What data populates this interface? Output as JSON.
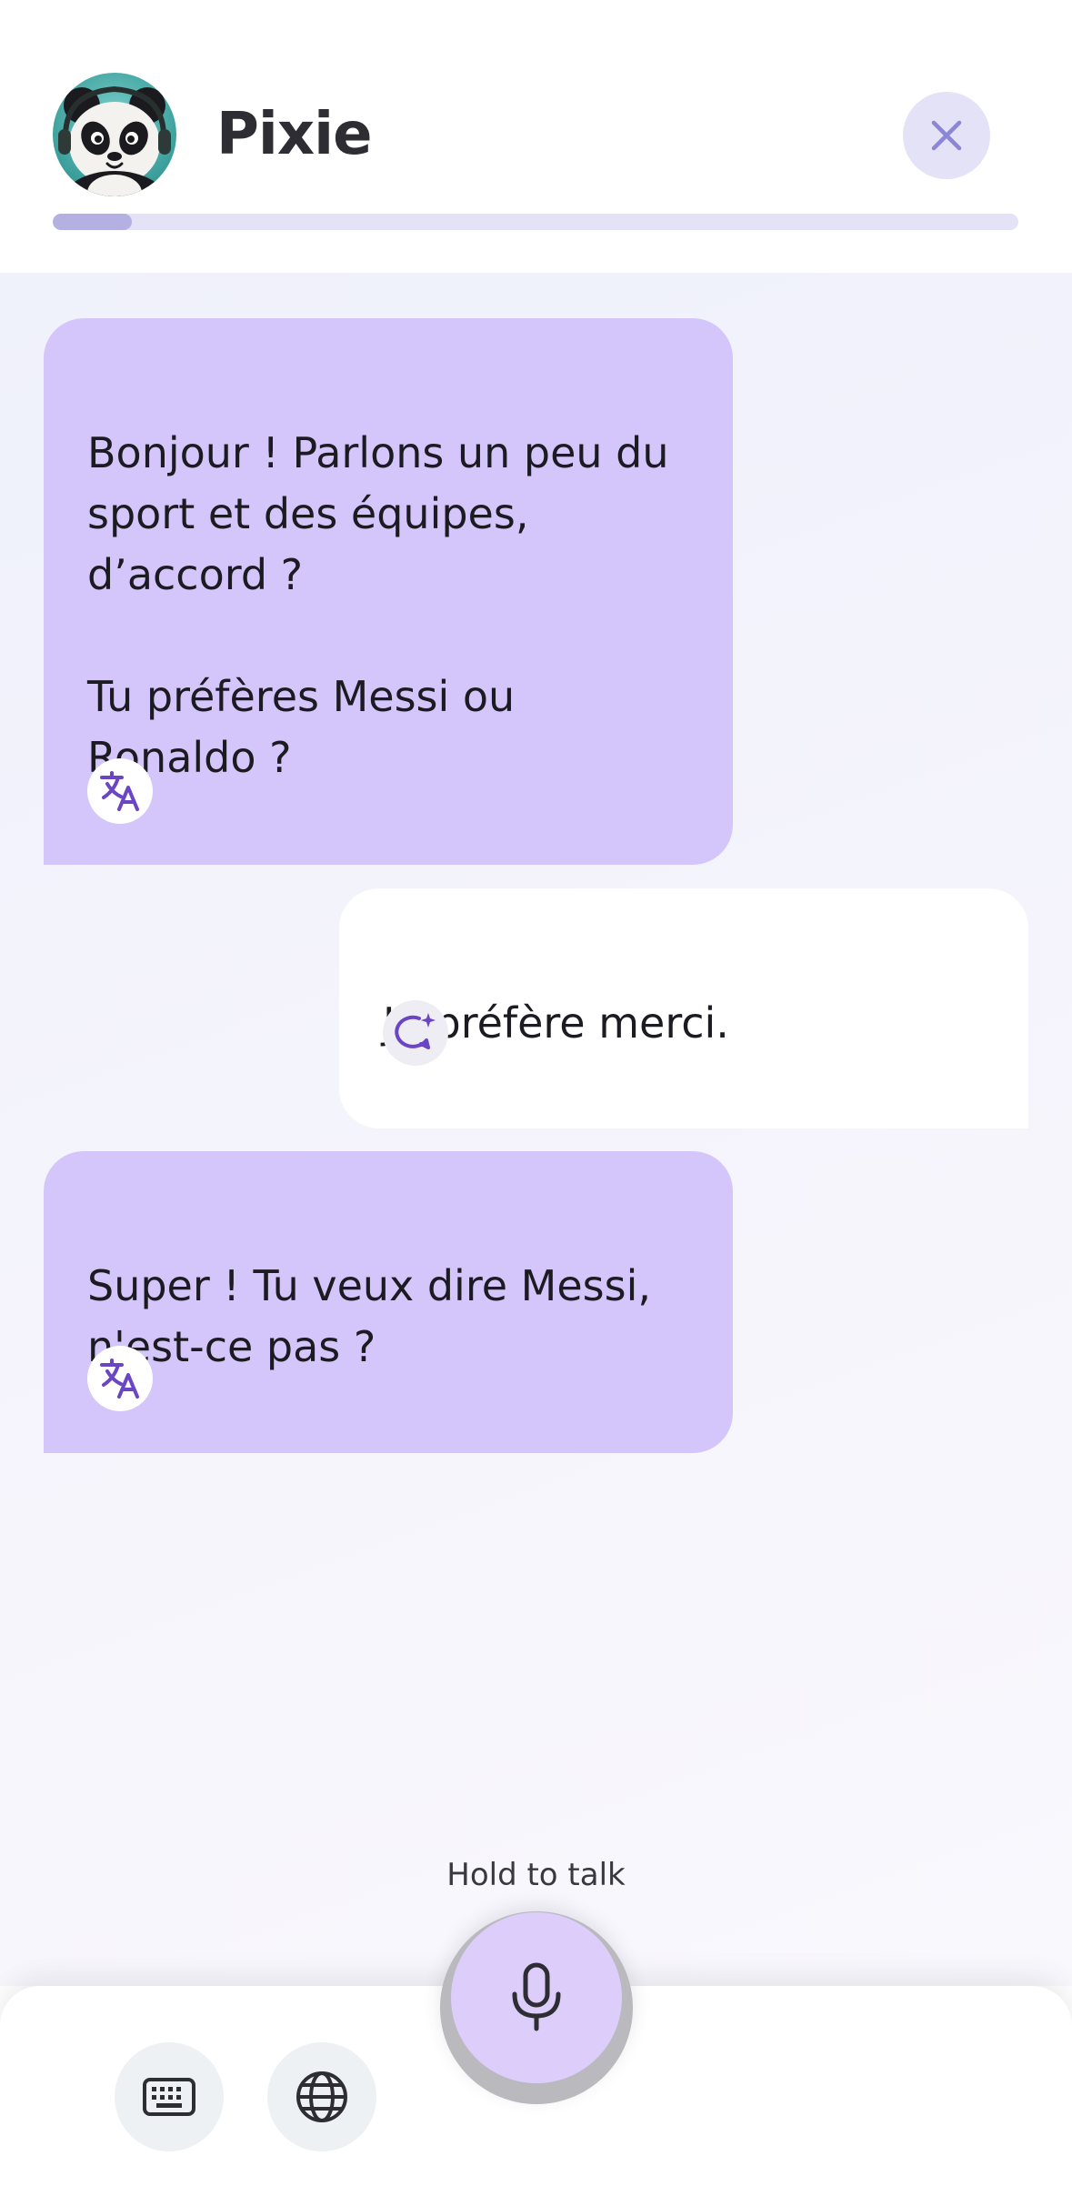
{
  "header": {
    "bot_name": "Pixie",
    "avatar_icon": "panda-avatar-icon",
    "close_icon": "close-icon",
    "progress_fraction": 0.082
  },
  "messages": [
    {
      "sender": "bot",
      "text": "Bonjour ! Parlons un peu du sport et des équipes, d’accord ?\n\nTu préfères Messi ou Ronaldo ?",
      "action_icon": "translate-icon"
    },
    {
      "sender": "user",
      "text": "Je préfère merci.",
      "action_icon": "feedback-sparkle-icon"
    },
    {
      "sender": "bot",
      "text": "Super ! Tu veux dire Messi, n'est-ce pas ?",
      "action_icon": "translate-icon"
    }
  ],
  "controls": {
    "hold_label": "Hold to talk",
    "mic_icon": "microphone-icon",
    "keyboard_icon": "keyboard-icon",
    "globe_icon": "globe-icon"
  },
  "colors": {
    "bot_bubble": "#d4c6fb",
    "user_bubble": "#ffffff",
    "accent": "#6a45c4",
    "progress_track": "#e4e2f6",
    "progress_fill": "#b4b0e2"
  }
}
